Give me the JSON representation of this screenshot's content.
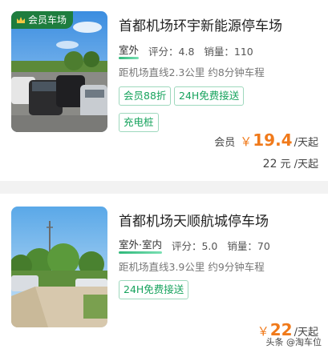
{
  "listings": [
    {
      "badge": "会员车场",
      "title": "首都机场环宇新能源停车场",
      "tags": [
        "室外"
      ],
      "rating_label": "评分：4.8",
      "sales_label": "销量：110",
      "distance": "距机场直线2.3公里 约8分钟车程",
      "chips": [
        "会员88折",
        "24H免费接送",
        "充电桩"
      ],
      "member_label": "会员",
      "member_price_symbol": "￥",
      "member_price": "19.4",
      "per_day_from": "/天起",
      "normal_price": "22",
      "normal_price_suffix": "元 /天起"
    },
    {
      "title": "首都机场天顺航城停车场",
      "tags": [
        "室外·室内"
      ],
      "rating_label": "评分：5.0",
      "sales_label": "销量：70",
      "distance": "距机场直线3.9公里 约9分钟车程",
      "chips": [
        "24H免费接送"
      ],
      "price_symbol": "￥",
      "price": "22",
      "per_day_from": "/天起"
    }
  ],
  "watermark": "头条 @淘车位",
  "colors": {
    "accent_price": "#f07a1b",
    "chip_green": "#18a35e",
    "badge_green": "#1e7d3e"
  }
}
